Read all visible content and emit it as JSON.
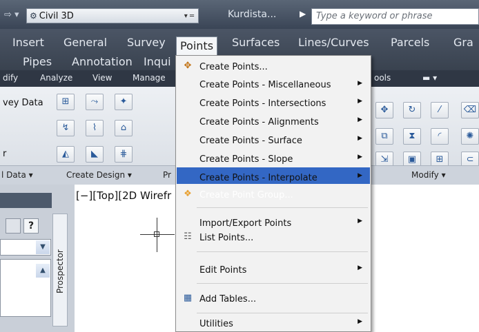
{
  "titlebar": {
    "nav_arrow": "⇨ ▾",
    "workspace": "Civil 3D",
    "title": "Kurdista...",
    "search_placeholder": "Type a keyword or phrase"
  },
  "menubar": {
    "row1": [
      "Insert",
      "General",
      "Survey",
      "Points",
      "Surfaces",
      "Lines/Curves",
      "Parcels",
      "Gra"
    ],
    "row2": [
      "Pipes",
      "Annotation",
      "Inqui"
    ]
  },
  "ribbon_tabs": [
    "dify",
    "Analyze",
    "View",
    "Manage",
    "ools"
  ],
  "ribbon": {
    "left_text": [
      "vey Data",
      "r"
    ],
    "footer": [
      "l Data ▾",
      "Create Design ▾",
      "Pr",
      "Modify ▾"
    ]
  },
  "prospector": {
    "label": "Prospector",
    "help": "?"
  },
  "viewport_label": "[−][Top][2D Wirefr",
  "menu": {
    "items": [
      {
        "label": "Create Points...",
        "icon": "create-points-icon",
        "submenu": false
      },
      {
        "label": "Create Points - Miscellaneous",
        "submenu": true
      },
      {
        "label": "Create Points - Intersections",
        "submenu": true
      },
      {
        "label": "Create Points - Alignments",
        "submenu": true
      },
      {
        "label": "Create Points - Surface",
        "submenu": true
      },
      {
        "label": "Create Points - Slope",
        "submenu": true
      },
      {
        "label": "Create Points - Interpolate",
        "submenu": true
      },
      {
        "label": "Create Point Group...",
        "icon": "point-group-icon",
        "submenu": false,
        "highlighted": true
      },
      {
        "label": "Import/Export Points",
        "submenu": true
      },
      {
        "label": "List Points...",
        "icon": "list-points-icon",
        "submenu": false
      },
      {
        "label": "Edit Points",
        "submenu": true
      },
      {
        "label": "Add Tables...",
        "icon": "table-icon",
        "submenu": false
      },
      {
        "label": "Utilities",
        "submenu": true
      }
    ]
  },
  "colors": {
    "highlight": "#3367c4",
    "menubar": "#4b5565"
  }
}
